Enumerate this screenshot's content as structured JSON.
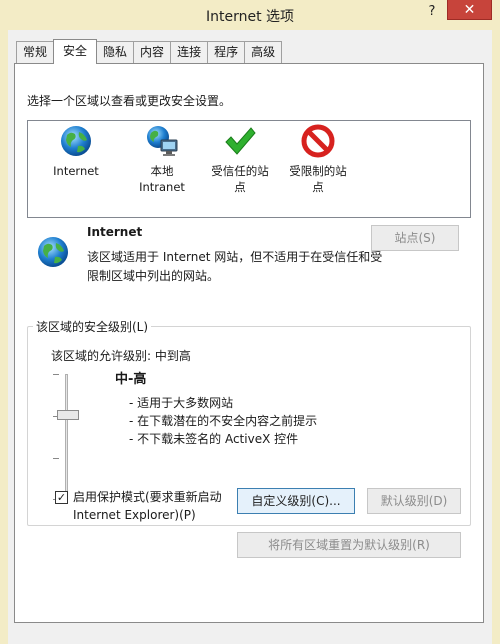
{
  "window": {
    "title": "Internet 选项",
    "help_glyph": "?",
    "close_glyph": "✕"
  },
  "tabs": [
    {
      "label": "常规",
      "active": false
    },
    {
      "label": "安全",
      "active": true
    },
    {
      "label": "隐私",
      "active": false
    },
    {
      "label": "内容",
      "active": false
    },
    {
      "label": "连接",
      "active": false
    },
    {
      "label": "程序",
      "active": false
    },
    {
      "label": "高级",
      "active": false
    }
  ],
  "security": {
    "prompt": "选择一个区域以查看或更改安全设置。",
    "zones": [
      {
        "label_line1": "Internet",
        "label_line2": "",
        "icon": "globe-icon"
      },
      {
        "label_line1": "本地",
        "label_line2": "Intranet",
        "icon": "network-icon"
      },
      {
        "label_line1": "受信任的站",
        "label_line2": "点",
        "icon": "check-icon"
      },
      {
        "label_line1": "受限制的站",
        "label_line2": "点",
        "icon": "restricted-icon"
      }
    ],
    "selected_zone": {
      "title": "Internet",
      "description": "该区域适用于 Internet 网站，但不适用于在受信任和受限制区域中列出的网站。"
    },
    "sites_button": "站点(S)",
    "group_label": "该区域的安全级别(L)",
    "allowed_level": "该区域的允许级别: 中到高",
    "level_name": "中-高",
    "level_points": [
      "- 适用于大多数网站",
      "- 在下载潜在的不安全内容之前提示",
      "- 不下载未签名的 ActiveX 控件"
    ],
    "protected_mode": {
      "checked": true,
      "label_line1": "启用保护模式(要求重新启动",
      "label_line2": "Internet Explorer)(P)"
    },
    "custom_level_button": "自定义级别(C)...",
    "default_level_button": "默认级别(D)",
    "reset_all_button": "将所有区域重置为默认级别(R)"
  },
  "colors": {
    "title_bar": "#f3ecc6",
    "close_button": "#c7443b"
  }
}
